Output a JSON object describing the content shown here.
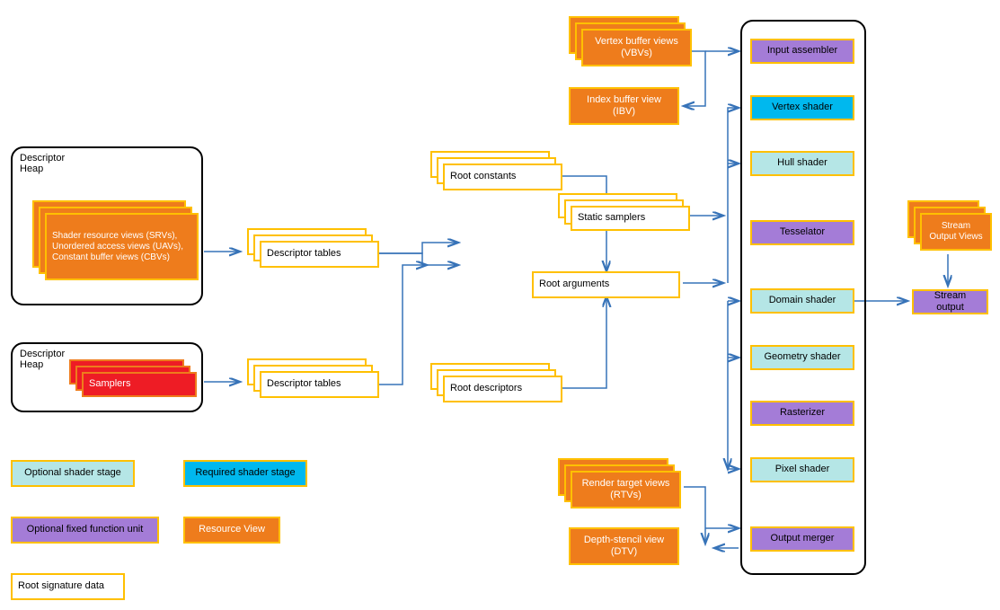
{
  "heap1": {
    "title": "Descriptor\nHeap",
    "content": "Shader resource views (SRVs),\nUnordered access views (UAVs),\nConstant buffer views (CBVs)"
  },
  "heap2": {
    "title": "Descriptor\nHeap",
    "content": "Samplers"
  },
  "desc_tables1": "Descriptor tables",
  "desc_tables2": "Descriptor tables",
  "root_constants": "Root constants",
  "root_args": "Root arguments",
  "root_descriptors": "Root descriptors",
  "static_samplers": "Static samplers",
  "vbv": "Vertex buffer views (VBVs)",
  "ibv": "Index buffer view (IBV)",
  "rtv": "Render target views (RTVs)",
  "dsv": "Depth-stencil view (DTV)",
  "so_views": "Stream Output Views",
  "pipeline": {
    "input_assembler": "Input assembler",
    "vertex_shader": "Vertex shader",
    "hull_shader": "Hull shader",
    "tesselator": "Tesselator",
    "domain_shader": "Domain shader",
    "geometry_shader": "Geometry shader",
    "rasterizer": "Rasterizer",
    "pixel_shader": "Pixel shader",
    "output_merger": "Output merger"
  },
  "stream_output": "Stream output",
  "legend": {
    "opt_shader": "Optional shader stage",
    "req_shader": "Required shader stage",
    "opt_fixed": "Optional fixed function unit",
    "resource_view": "Resource View",
    "root_sig": "Root signature data"
  }
}
